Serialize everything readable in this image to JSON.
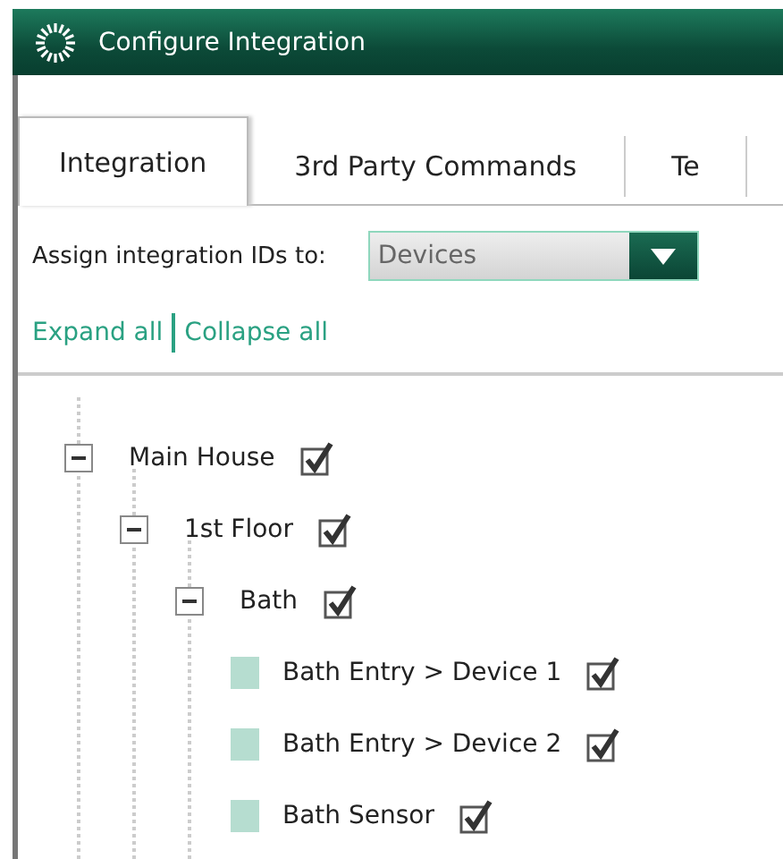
{
  "window": {
    "title": "Configure Integration"
  },
  "tabs": [
    {
      "label": "Integration",
      "selected": true
    },
    {
      "label": "3rd Party Commands",
      "selected": false
    },
    {
      "label": "Te",
      "selected": false
    }
  ],
  "assign": {
    "label": "Assign integration IDs to:",
    "value": "Devices"
  },
  "links": [
    "Expand all",
    "Collapse all"
  ],
  "tree": [
    {
      "label": "Main House",
      "kind": "group",
      "expanded": true,
      "checked": true,
      "children": [
        {
          "label": "1st Floor",
          "kind": "group",
          "expanded": true,
          "checked": true,
          "children": [
            {
              "label": "Bath",
              "kind": "group",
              "expanded": true,
              "checked": true,
              "children": [
                {
                  "label": "Bath Entry > Device 1",
                  "kind": "leaf",
                  "checked": true
                },
                {
                  "label": "Bath Entry > Device 2",
                  "kind": "leaf",
                  "checked": true
                },
                {
                  "label": "Bath Sensor",
                  "kind": "leaf",
                  "checked": true
                }
              ]
            }
          ]
        }
      ]
    }
  ]
}
